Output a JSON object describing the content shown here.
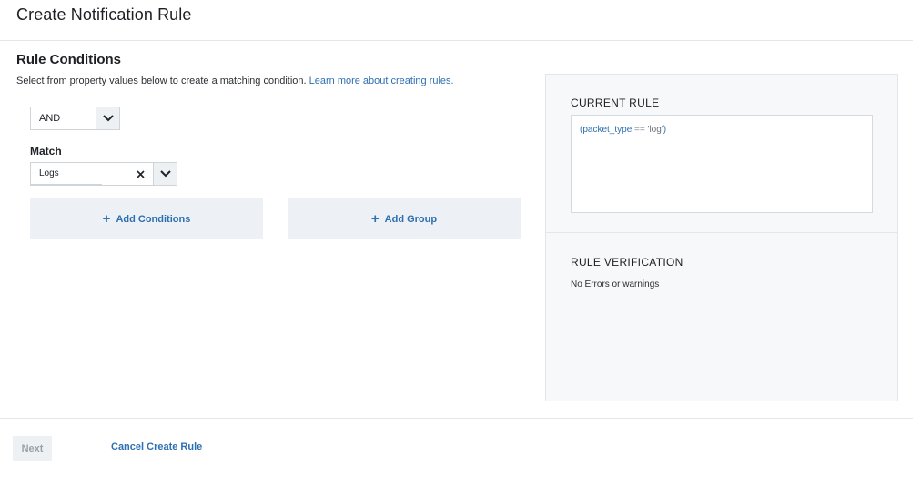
{
  "page": {
    "title": "Create Notification Rule"
  },
  "conditions": {
    "title": "Rule Conditions",
    "description": "Select from property values below to create a matching condition.",
    "learn_more_link": "Learn more about creating rules.",
    "operator_select": {
      "value": "AND",
      "icon": "chevron-down-icon"
    },
    "match_label": "Match",
    "match_select": {
      "value": "Logs",
      "clear_icon": "close-icon",
      "icon": "chevron-down-icon"
    },
    "add_conditions_label": "Add Conditions",
    "add_group_label": "Add Group",
    "add_icon": "plus-icon"
  },
  "current_rule": {
    "heading": "CURRENT RULE",
    "expression": {
      "open": "(",
      "field": "packet_type",
      "operator": " == ",
      "value": "'log'",
      "close": ")"
    }
  },
  "verification": {
    "heading": "RULE VERIFICATION",
    "message": "No Errors or warnings"
  },
  "footer": {
    "next_label": "Next",
    "cancel_label": "Cancel Create Rule"
  },
  "colors": {
    "accent": "#2e6fb0",
    "panel_bg": "#f6f8fa",
    "button_bg": "#edf1f5",
    "border": "#e3e6ea"
  }
}
